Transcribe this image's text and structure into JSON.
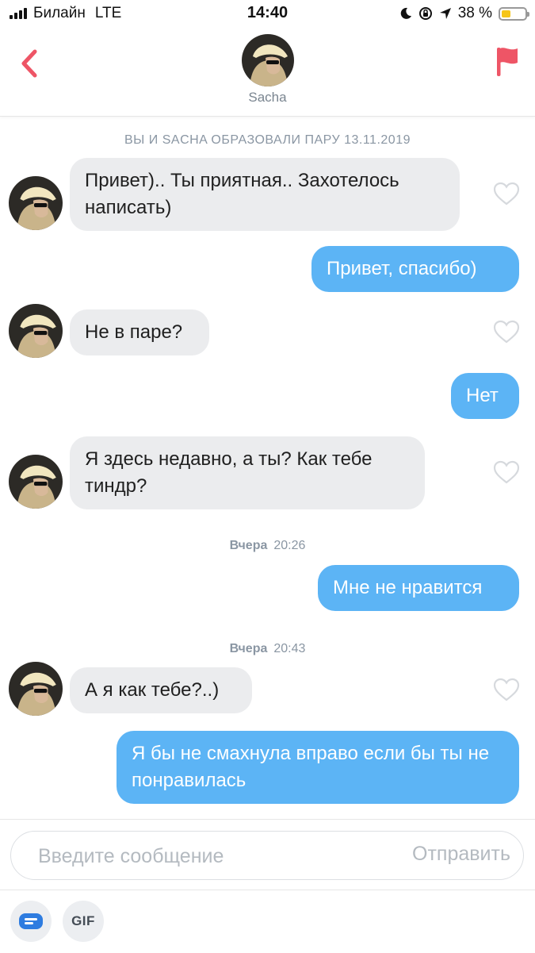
{
  "status_bar": {
    "carrier": "Билайн",
    "network": "LTE",
    "time": "14:40",
    "battery_percent": "38 %",
    "battery_level": 0.38
  },
  "header": {
    "name": "Sacha",
    "back_icon": "chevron-left-icon",
    "flag_icon": "flag-icon",
    "accent_color": "#ee5566"
  },
  "chat": {
    "match_note": "ВЫ И SACHA ОБРАЗОВАЛИ ПАРУ 13.11.2019",
    "messages": [
      {
        "from": "them",
        "text": "Привет).. Ты приятная.. Захотелось написать)"
      },
      {
        "from": "me",
        "text": "Привет, спасибо)"
      },
      {
        "from": "them",
        "text": "Не в паре?"
      },
      {
        "from": "me",
        "text": "Нет"
      },
      {
        "from": "them",
        "text": "Я здесь недавно, а ты? Как тебе тиндр?"
      },
      {
        "from": "me",
        "text": "Мне не нравится"
      },
      {
        "from": "them",
        "text": "А я как тебе?..)"
      },
      {
        "from": "me",
        "text": "Я бы не смахнула вправо если бы ты не понравилась"
      }
    ],
    "timestamps": [
      {
        "day": "Вчера",
        "time": "20:26"
      },
      {
        "day": "Вчера",
        "time": "20:43"
      }
    ],
    "incoming_bubble_color": "#ebecee",
    "outgoing_bubble_color": "#5cb4f5"
  },
  "composer": {
    "placeholder": "Введите сообщение",
    "send_label": "Отправить",
    "gif_label": "GIF",
    "sticker_icon": "sticker-icon"
  }
}
